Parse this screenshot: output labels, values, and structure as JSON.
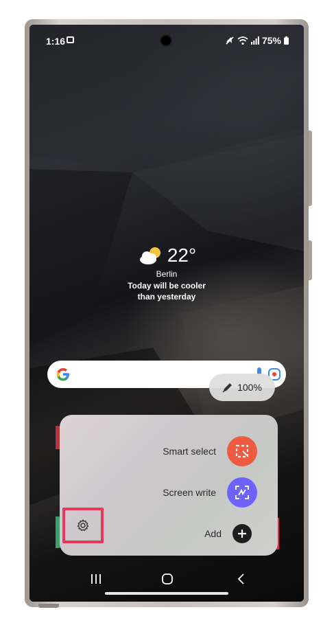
{
  "status_bar": {
    "time": "1:16",
    "battery": "75%",
    "icons": [
      "gallery-icon",
      "mute-icon",
      "wifi-icon",
      "signal-icon",
      "battery-icon"
    ]
  },
  "weather": {
    "temperature": "22°",
    "city": "Berlin",
    "forecast_line1": "Today will be cooler",
    "forecast_line2": "than yesterday",
    "icon": "partly-cloudy-icon"
  },
  "search_bar": {
    "icons": [
      "google-logo",
      "mic-icon",
      "lens-icon"
    ]
  },
  "pen_zoom": {
    "value": "100%",
    "icon": "pen-icon"
  },
  "air_command": {
    "items": [
      {
        "label": "Smart select",
        "icon": "smart-select-icon",
        "color": "#f05a40"
      },
      {
        "label": "Screen write",
        "icon": "screen-write-icon",
        "color": "#6c63ff"
      },
      {
        "label": "Add",
        "icon": "plus-icon",
        "color": "#1d1d1d"
      }
    ],
    "settings_icon": "gear-icon",
    "highlight_color": "#e8375a"
  },
  "nav_bar": {
    "items": [
      "recents-icon",
      "home-icon",
      "back-icon"
    ]
  }
}
